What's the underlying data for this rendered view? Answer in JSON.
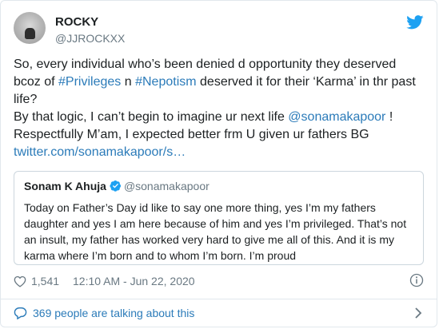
{
  "author": {
    "name": "ROCKY",
    "handle": "@JJROCKXX"
  },
  "tweet": {
    "line1": "So, every individual who’s been denied d opportunity they deserved",
    "line2_pre": "bcoz of ",
    "hashtag1": "#Privileges",
    "line2_mid": " n ",
    "hashtag2": "#Nepotism",
    "line2_post": " deserved it for their ‘Karma’ in thr past",
    "line3": "life?",
    "line4_pre": "By that logic, I can’t begin to imagine ur next life ",
    "mention": "@sonamakapoor",
    "line4_post": " !",
    "line5": "Respectfully M’am, I expected better frm U given ur fathers BG",
    "link": "twitter.com/sonamakapoor/s…"
  },
  "quoted_tweet": {
    "name": "Sonam K Ahuja",
    "handle": "@sonamakapoor",
    "text": "Today on Father’s Day id like to say one more thing, yes I’m my fathers daughter and yes I am here because of him and yes I’m privileged. That’s not an insult, my father has worked very hard to give me all of this. And it is my karma where I’m born and to whom I’m born. I’m proud"
  },
  "meta": {
    "likes": "1,541",
    "timestamp": "12:10 AM - Jun 22, 2020"
  },
  "footer": {
    "talking": "369 people are talking about this"
  },
  "colors": {
    "link": "#2b7bb9",
    "twitter_blue": "#1da1f2",
    "muted": "#697882",
    "border": "#e1e8ed"
  },
  "icons": [
    "twitter-bird-icon",
    "verified-badge-icon",
    "heart-icon",
    "info-icon",
    "comment-icon",
    "chevron-right-icon"
  ]
}
